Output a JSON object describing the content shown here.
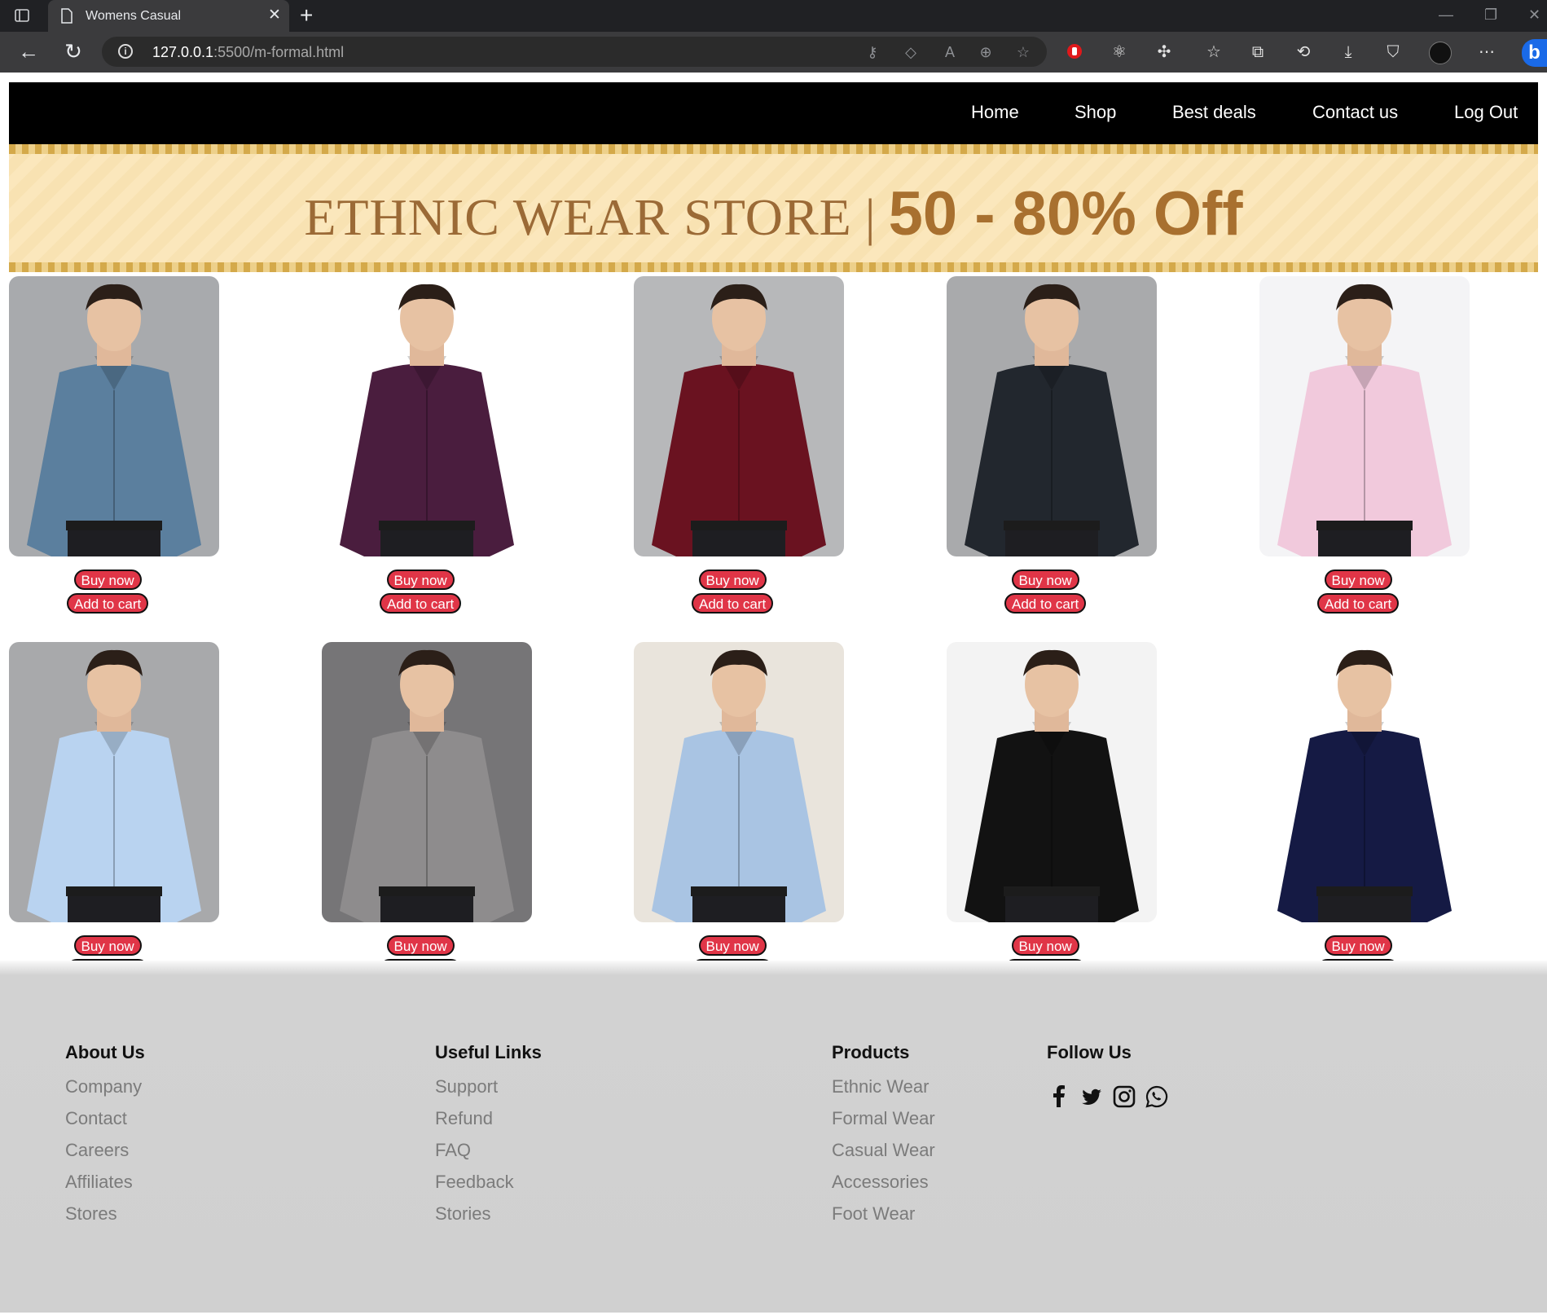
{
  "browser": {
    "tab_title": "Womens Casual",
    "url_host": "127.0.0.1",
    "url_rest": ":5500/m-formal.html"
  },
  "nav": {
    "home": "Home",
    "shop": "Shop",
    "best_deals": "Best deals",
    "contact": "Contact us",
    "logout": "Log Out"
  },
  "banner": {
    "store": "ETHNIC WEAR STORE",
    "separator": "|",
    "offer": "50 - 80% Off"
  },
  "products": [
    {
      "shirt": "#5b7f9e",
      "background": "#a8aaad",
      "buy": "Buy now",
      "cart": "Add to cart"
    },
    {
      "shirt": "#4a1d3e",
      "background": "#ffffff",
      "buy": "Buy now",
      "cart": "Add to cart"
    },
    {
      "shirt": "#6a1220",
      "background": "#b7b8ba",
      "buy": "Buy now",
      "cart": "Add to cart"
    },
    {
      "shirt": "#22272e",
      "background": "#a9aaac",
      "buy": "Buy now",
      "cart": "Add to cart"
    },
    {
      "shirt": "#f1c9dc",
      "background": "#f4f4f6",
      "buy": "Buy now",
      "cart": "Add to cart"
    },
    {
      "shirt": "#b9d3f0",
      "background": "#a8a9ab",
      "buy": "Buy now",
      "cart": "Add to cart"
    },
    {
      "shirt": "#8e8c8d",
      "background": "#767577",
      "buy": "Buy now",
      "cart": "Add to cart"
    },
    {
      "shirt": "#a9c4e3",
      "background": "#e9e4dc",
      "buy": "Buy now",
      "cart": "Add to cart"
    },
    {
      "shirt": "#121212",
      "background": "#f3f3f3",
      "buy": "Buy now",
      "cart": "Add to cart"
    },
    {
      "shirt": "#151a44",
      "background": "#ffffff",
      "buy": "Buy now",
      "cart": "Add to cart"
    }
  ],
  "footer": {
    "about": {
      "title": "About Us",
      "links": [
        "Company",
        "Contact",
        "Careers",
        "Affiliates",
        "Stores"
      ]
    },
    "useful": {
      "title": "Useful Links",
      "links": [
        "Support",
        "Refund",
        "FAQ",
        "Feedback",
        "Stories"
      ]
    },
    "products": {
      "title": "Products",
      "links": [
        "Ethnic Wear",
        "Formal Wear",
        "Casual Wear",
        "Accessories",
        "Foot Wear"
      ]
    },
    "follow": {
      "title": "Follow Us",
      "icons": [
        "facebook-icon",
        "twitter-icon",
        "instagram-icon",
        "whatsapp-icon"
      ]
    }
  },
  "colors": {
    "nav_bg": "#000000",
    "button": "#e03547",
    "footer_bg": "#d0d0d0",
    "link_gray": "#7b7b7b"
  }
}
